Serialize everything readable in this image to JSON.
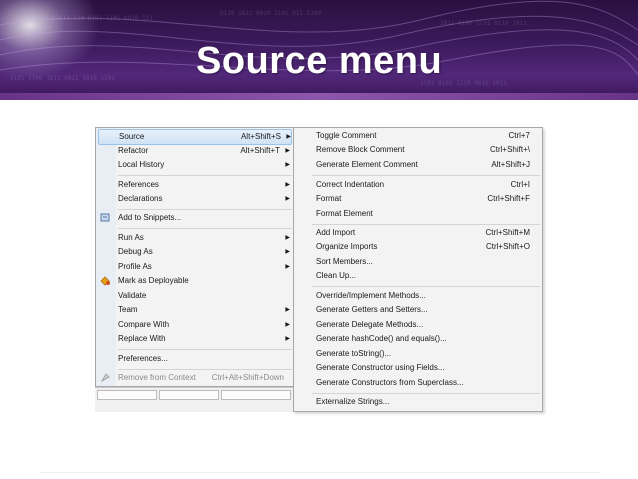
{
  "slide": {
    "title": "Source menu"
  },
  "left_menu": {
    "items": [
      {
        "label": "Source",
        "shortcut": "Alt+Shift+S",
        "submenu": true,
        "highlighted": true
      },
      {
        "label": "Refactor",
        "shortcut": "Alt+Shift+T",
        "submenu": true
      },
      {
        "label": "Local History",
        "shortcut": "",
        "submenu": true
      },
      {
        "label": "References",
        "shortcut": "",
        "submenu": true
      },
      {
        "label": "Declarations",
        "shortcut": "",
        "submenu": true
      },
      {
        "label": "Add to Snippets...",
        "shortcut": "",
        "submenu": false,
        "icon": "snippet-icon"
      },
      {
        "label": "Run As",
        "shortcut": "",
        "submenu": true
      },
      {
        "label": "Debug As",
        "shortcut": "",
        "submenu": true
      },
      {
        "label": "Profile As",
        "shortcut": "",
        "submenu": true
      },
      {
        "label": "Mark as Deployable",
        "shortcut": "",
        "submenu": false,
        "icon": "deploy-icon"
      },
      {
        "label": "Validate",
        "shortcut": "",
        "submenu": false
      },
      {
        "label": "Team",
        "shortcut": "",
        "submenu": true
      },
      {
        "label": "Compare With",
        "shortcut": "",
        "submenu": true
      },
      {
        "label": "Replace With",
        "shortcut": "",
        "submenu": true
      },
      {
        "label": "Preferences...",
        "shortcut": "",
        "submenu": false
      },
      {
        "label": "Remove from Context",
        "shortcut": "Ctrl+Alt+Shift+Down",
        "submenu": false,
        "disabled": true,
        "icon": "remove-context-icon"
      }
    ]
  },
  "right_menu": {
    "items": [
      {
        "label": "Toggle Comment",
        "shortcut": "Ctrl+7"
      },
      {
        "label": "Remove Block Comment",
        "shortcut": "Ctrl+Shift+\\"
      },
      {
        "label": "Generate Element Comment",
        "shortcut": "Alt+Shift+J"
      },
      {
        "label": "Correct Indentation",
        "shortcut": "Ctrl+I"
      },
      {
        "label": "Format",
        "shortcut": "Ctrl+Shift+F"
      },
      {
        "label": "Format Element",
        "shortcut": ""
      },
      {
        "label": "Add Import",
        "shortcut": "Ctrl+Shift+M"
      },
      {
        "label": "Organize Imports",
        "shortcut": "Ctrl+Shift+O"
      },
      {
        "label": "Sort Members...",
        "shortcut": ""
      },
      {
        "label": "Clean Up...",
        "shortcut": ""
      },
      {
        "label": "Override/Implement Methods...",
        "shortcut": ""
      },
      {
        "label": "Generate Getters and Setters...",
        "shortcut": ""
      },
      {
        "label": "Generate Delegate Methods...",
        "shortcut": ""
      },
      {
        "label": "Generate hashCode() and equals()...",
        "shortcut": ""
      },
      {
        "label": "Generate toString()...",
        "shortcut": ""
      },
      {
        "label": "Generate Constructor using Fields...",
        "shortcut": ""
      },
      {
        "label": "Generate Constructors from Superclass...",
        "shortcut": ""
      },
      {
        "label": "Externalize Strings...",
        "shortcut": ""
      }
    ]
  },
  "colors": {
    "banner": "#3d1a5c",
    "highlight": "#cfe2f6",
    "title": "#ffffff"
  }
}
